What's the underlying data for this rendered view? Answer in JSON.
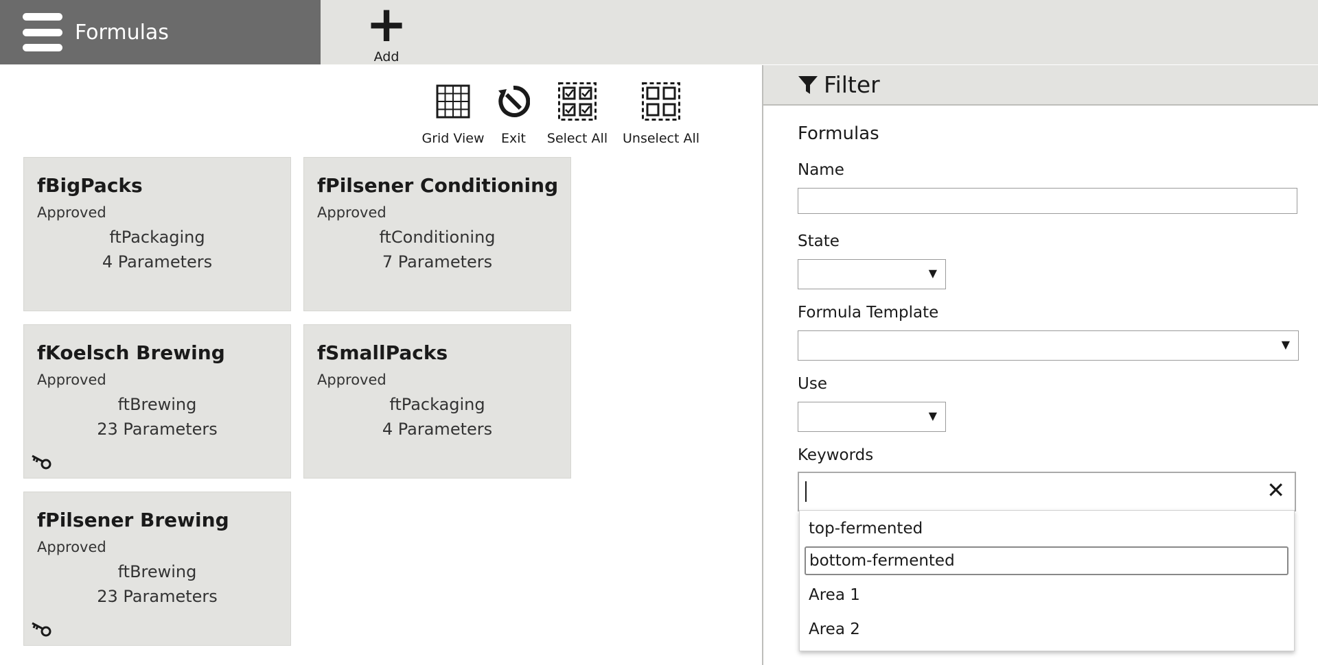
{
  "header": {
    "title": "Formulas",
    "add_label": "Add"
  },
  "toolbar": {
    "grid_view": "Grid View",
    "exit": "Exit",
    "select_all": "Select All",
    "unselect_all": "Unselect All"
  },
  "cards": [
    {
      "title": "fBigPacks",
      "state": "Approved",
      "template": "ftPackaging",
      "params": "4 Parameters",
      "has_key": false
    },
    {
      "title": "fPilsener Conditioning",
      "state": "Approved",
      "template": "ftConditioning",
      "params": "7 Parameters",
      "has_key": false
    },
    {
      "title": "fKoelsch Brewing",
      "state": "Approved",
      "template": "ftBrewing",
      "params": "23 Parameters",
      "has_key": true
    },
    {
      "title": "fSmallPacks",
      "state": "Approved",
      "template": "ftPackaging",
      "params": "4 Parameters",
      "has_key": false
    },
    {
      "title": "fPilsener Brewing",
      "state": "Approved",
      "template": "ftBrewing",
      "params": "23 Parameters",
      "has_key": true
    }
  ],
  "filter": {
    "title": "Filter",
    "section": "Formulas",
    "name_label": "Name",
    "name_value": "",
    "state_label": "State",
    "state_value": "",
    "template_label": "Formula Template",
    "template_value": "",
    "use_label": "Use",
    "use_value": "",
    "keywords_label": "Keywords",
    "keywords_value": "",
    "keyword_options": [
      "top-fermented",
      "bottom-fermented",
      "Area 1",
      "Area 2"
    ],
    "focused_option": "bottom-fermented"
  },
  "colors": {
    "header_dark": "#6b6b6b",
    "panel_grey": "#e3e3e0"
  },
  "icons": {
    "menu": "hamburger-icon",
    "add": "plus-icon",
    "filter": "funnel-icon",
    "key": "key-icon",
    "clear": "close-icon"
  }
}
